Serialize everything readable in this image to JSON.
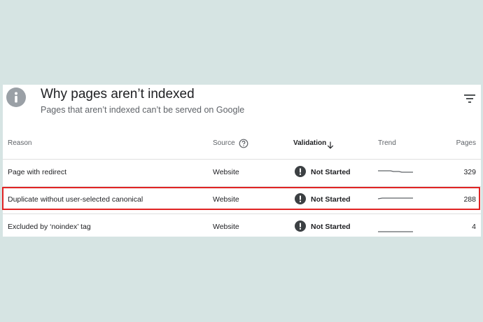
{
  "header": {
    "title": "Why pages aren’t indexed",
    "subtitle": "Pages that aren’t indexed can’t be served on Google"
  },
  "table": {
    "columns": {
      "reason": "Reason",
      "source": "Source",
      "validation": "Validation",
      "trend": "Trend",
      "pages": "Pages"
    },
    "rows": [
      {
        "reason": "Page with redirect",
        "source": "Website",
        "validation": "Not Started",
        "pages": "329"
      },
      {
        "reason": "Duplicate without user-selected canonical",
        "source": "Website",
        "validation": "Not Started",
        "pages": "288"
      },
      {
        "reason": "Excluded by ‘noindex’ tag",
        "source": "Website",
        "validation": "Not Started",
        "pages": "4"
      }
    ]
  },
  "colors": {
    "highlight": "#e02424",
    "status_icon": "#3c4043",
    "background": "#d6e4e3"
  },
  "icons": [
    "info-icon",
    "filter-icon",
    "help-icon",
    "sort-arrow-down-icon",
    "status-alert-icon"
  ]
}
